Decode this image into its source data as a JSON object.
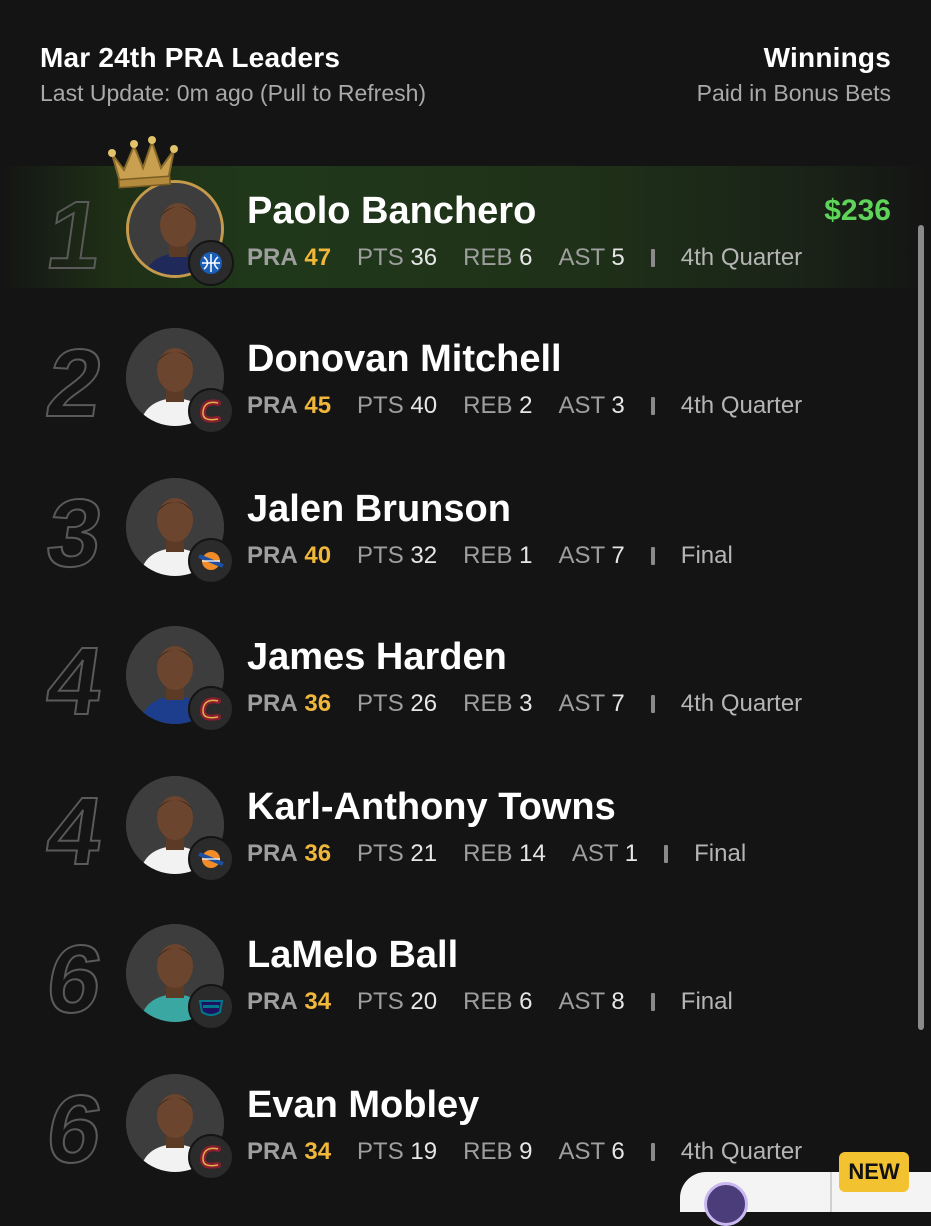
{
  "header": {
    "title": "Mar 24th PRA Leaders",
    "subtitle": "Last Update: 0m ago (Pull to Refresh)",
    "right_title": "Winnings",
    "right_subtitle": "Paid in Bonus Bets"
  },
  "labels": {
    "pra": "PRA",
    "pts": "PTS",
    "reb": "REB",
    "ast": "AST"
  },
  "players": [
    {
      "rank": "1",
      "name": "Paolo Banchero",
      "pra": "47",
      "pts": "36",
      "reb": "6",
      "ast": "5",
      "status": "4th Quarter",
      "winnings": "$236",
      "team_icon": "magic-logo-icon",
      "jersey": "#1f2a5a"
    },
    {
      "rank": "2",
      "name": "Donovan Mitchell",
      "pra": "45",
      "pts": "40",
      "reb": "2",
      "ast": "3",
      "status": "4th Quarter",
      "team_icon": "cavaliers-logo-icon",
      "jersey": "#f2f2f2"
    },
    {
      "rank": "3",
      "name": "Jalen Brunson",
      "pra": "40",
      "pts": "32",
      "reb": "1",
      "ast": "7",
      "status": "Final",
      "team_icon": "knicks-logo-icon",
      "jersey": "#f2f2f2"
    },
    {
      "rank": "4",
      "name": "James Harden",
      "pra": "36",
      "pts": "26",
      "reb": "3",
      "ast": "7",
      "status": "4th Quarter",
      "team_icon": "cavaliers-logo-icon",
      "jersey": "#1d3e8c"
    },
    {
      "rank": "4",
      "name": "Karl-Anthony Towns",
      "pra": "36",
      "pts": "21",
      "reb": "14",
      "ast": "1",
      "status": "Final",
      "team_icon": "knicks-logo-icon",
      "jersey": "#f2f2f2"
    },
    {
      "rank": "6",
      "name": "LaMelo Ball",
      "pra": "34",
      "pts": "20",
      "reb": "6",
      "ast": "8",
      "status": "Final",
      "team_icon": "hornets-logo-icon",
      "jersey": "#3aa7a3"
    },
    {
      "rank": "6",
      "name": "Evan Mobley",
      "pra": "34",
      "pts": "19",
      "reb": "9",
      "ast": "6",
      "status": "4th Quarter",
      "team_icon": "cavaliers-logo-icon",
      "jersey": "#f2f2f2"
    }
  ],
  "badge": {
    "new": "NEW"
  },
  "colors": {
    "accent_gold": "#f0b73b",
    "winnings_green": "#5fd45a",
    "leader_bg": "#20381a"
  }
}
